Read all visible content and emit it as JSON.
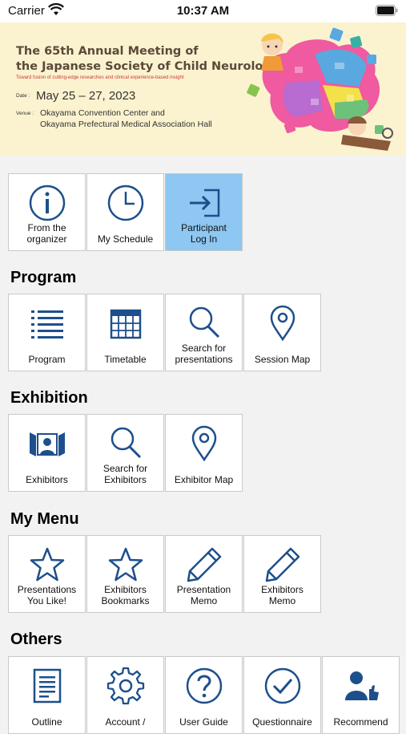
{
  "status_bar": {
    "carrier": "Carrier",
    "time": "10:37 AM"
  },
  "banner": {
    "title_line1": "The 65th Annual Meeting of",
    "title_line2": "the Japanese Society of Child Neurology",
    "subtitle": "Toward fusion of cutting-edge researches and clinical experience-based insight",
    "date_label": "Date :",
    "date": "May 25 – 27, 2023",
    "venue_label": "Venue :",
    "venue_line1": "Okayama Convention Center and",
    "venue_line2": "Okayama Prefectural Medical Association Hall"
  },
  "top_menu": [
    {
      "label": "From the\norganizer",
      "icon": "info-icon"
    },
    {
      "label": "My Schedule",
      "icon": "clock-icon"
    },
    {
      "label": "Participant\nLog In",
      "icon": "login-icon",
      "active": true
    }
  ],
  "sections": {
    "program": {
      "title": "Program",
      "items": [
        {
          "label": "Program",
          "icon": "list-icon"
        },
        {
          "label": "Timetable",
          "icon": "calendar-icon"
        },
        {
          "label": "Search for\npresentations",
          "icon": "search-icon"
        },
        {
          "label": "Session Map",
          "icon": "map-pin-icon"
        }
      ]
    },
    "exhibition": {
      "title": "Exhibition",
      "items": [
        {
          "label": "Exhibitors",
          "icon": "exhibitor-icon"
        },
        {
          "label": "Search for\nExhibitors",
          "icon": "search-icon"
        },
        {
          "label": "Exhibitor Map",
          "icon": "map-pin-icon"
        }
      ]
    },
    "my_menu": {
      "title": "My Menu",
      "items": [
        {
          "label": "Presentations\nYou Like!",
          "icon": "star-icon"
        },
        {
          "label": "Exhibitors\nBookmarks",
          "icon": "star-icon"
        },
        {
          "label": "Presentation\nMemo",
          "icon": "pencil-icon"
        },
        {
          "label": "Exhibitors\nMemo",
          "icon": "pencil-icon"
        }
      ]
    },
    "others": {
      "title": "Others",
      "items": [
        {
          "label": "Outline",
          "icon": "document-icon"
        },
        {
          "label": "Account /",
          "icon": "gear-icon"
        },
        {
          "label": "User Guide",
          "icon": "help-icon"
        },
        {
          "label": "Questionnaire",
          "icon": "check-circle-icon"
        },
        {
          "label": "Recommend",
          "icon": "recommend-icon"
        }
      ]
    }
  },
  "colors": {
    "icon_blue": "#1d4f8c",
    "active_tile": "#8dc7f2",
    "banner_bg": "#fbf3cf"
  }
}
